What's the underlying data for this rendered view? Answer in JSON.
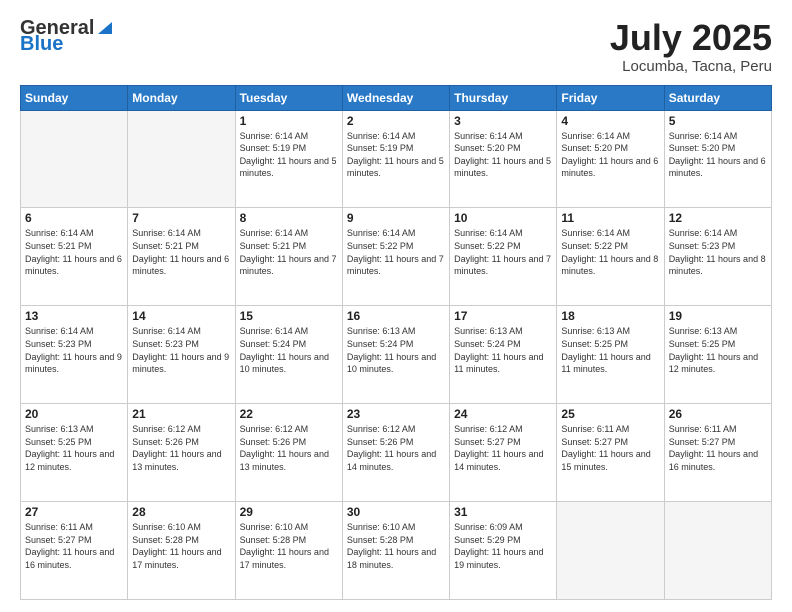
{
  "header": {
    "logo_general": "General",
    "logo_blue": "Blue",
    "month": "July 2025",
    "location": "Locumba, Tacna, Peru"
  },
  "weekdays": [
    "Sunday",
    "Monday",
    "Tuesday",
    "Wednesday",
    "Thursday",
    "Friday",
    "Saturday"
  ],
  "weeks": [
    [
      {
        "day": "",
        "info": ""
      },
      {
        "day": "",
        "info": ""
      },
      {
        "day": "1",
        "info": "Sunrise: 6:14 AM\nSunset: 5:19 PM\nDaylight: 11 hours and 5 minutes."
      },
      {
        "day": "2",
        "info": "Sunrise: 6:14 AM\nSunset: 5:19 PM\nDaylight: 11 hours and 5 minutes."
      },
      {
        "day": "3",
        "info": "Sunrise: 6:14 AM\nSunset: 5:20 PM\nDaylight: 11 hours and 5 minutes."
      },
      {
        "day": "4",
        "info": "Sunrise: 6:14 AM\nSunset: 5:20 PM\nDaylight: 11 hours and 6 minutes."
      },
      {
        "day": "5",
        "info": "Sunrise: 6:14 AM\nSunset: 5:20 PM\nDaylight: 11 hours and 6 minutes."
      }
    ],
    [
      {
        "day": "6",
        "info": "Sunrise: 6:14 AM\nSunset: 5:21 PM\nDaylight: 11 hours and 6 minutes."
      },
      {
        "day": "7",
        "info": "Sunrise: 6:14 AM\nSunset: 5:21 PM\nDaylight: 11 hours and 6 minutes."
      },
      {
        "day": "8",
        "info": "Sunrise: 6:14 AM\nSunset: 5:21 PM\nDaylight: 11 hours and 7 minutes."
      },
      {
        "day": "9",
        "info": "Sunrise: 6:14 AM\nSunset: 5:22 PM\nDaylight: 11 hours and 7 minutes."
      },
      {
        "day": "10",
        "info": "Sunrise: 6:14 AM\nSunset: 5:22 PM\nDaylight: 11 hours and 7 minutes."
      },
      {
        "day": "11",
        "info": "Sunrise: 6:14 AM\nSunset: 5:22 PM\nDaylight: 11 hours and 8 minutes."
      },
      {
        "day": "12",
        "info": "Sunrise: 6:14 AM\nSunset: 5:23 PM\nDaylight: 11 hours and 8 minutes."
      }
    ],
    [
      {
        "day": "13",
        "info": "Sunrise: 6:14 AM\nSunset: 5:23 PM\nDaylight: 11 hours and 9 minutes."
      },
      {
        "day": "14",
        "info": "Sunrise: 6:14 AM\nSunset: 5:23 PM\nDaylight: 11 hours and 9 minutes."
      },
      {
        "day": "15",
        "info": "Sunrise: 6:14 AM\nSunset: 5:24 PM\nDaylight: 11 hours and 10 minutes."
      },
      {
        "day": "16",
        "info": "Sunrise: 6:13 AM\nSunset: 5:24 PM\nDaylight: 11 hours and 10 minutes."
      },
      {
        "day": "17",
        "info": "Sunrise: 6:13 AM\nSunset: 5:24 PM\nDaylight: 11 hours and 11 minutes."
      },
      {
        "day": "18",
        "info": "Sunrise: 6:13 AM\nSunset: 5:25 PM\nDaylight: 11 hours and 11 minutes."
      },
      {
        "day": "19",
        "info": "Sunrise: 6:13 AM\nSunset: 5:25 PM\nDaylight: 11 hours and 12 minutes."
      }
    ],
    [
      {
        "day": "20",
        "info": "Sunrise: 6:13 AM\nSunset: 5:25 PM\nDaylight: 11 hours and 12 minutes."
      },
      {
        "day": "21",
        "info": "Sunrise: 6:12 AM\nSunset: 5:26 PM\nDaylight: 11 hours and 13 minutes."
      },
      {
        "day": "22",
        "info": "Sunrise: 6:12 AM\nSunset: 5:26 PM\nDaylight: 11 hours and 13 minutes."
      },
      {
        "day": "23",
        "info": "Sunrise: 6:12 AM\nSunset: 5:26 PM\nDaylight: 11 hours and 14 minutes."
      },
      {
        "day": "24",
        "info": "Sunrise: 6:12 AM\nSunset: 5:27 PM\nDaylight: 11 hours and 14 minutes."
      },
      {
        "day": "25",
        "info": "Sunrise: 6:11 AM\nSunset: 5:27 PM\nDaylight: 11 hours and 15 minutes."
      },
      {
        "day": "26",
        "info": "Sunrise: 6:11 AM\nSunset: 5:27 PM\nDaylight: 11 hours and 16 minutes."
      }
    ],
    [
      {
        "day": "27",
        "info": "Sunrise: 6:11 AM\nSunset: 5:27 PM\nDaylight: 11 hours and 16 minutes."
      },
      {
        "day": "28",
        "info": "Sunrise: 6:10 AM\nSunset: 5:28 PM\nDaylight: 11 hours and 17 minutes."
      },
      {
        "day": "29",
        "info": "Sunrise: 6:10 AM\nSunset: 5:28 PM\nDaylight: 11 hours and 17 minutes."
      },
      {
        "day": "30",
        "info": "Sunrise: 6:10 AM\nSunset: 5:28 PM\nDaylight: 11 hours and 18 minutes."
      },
      {
        "day": "31",
        "info": "Sunrise: 6:09 AM\nSunset: 5:29 PM\nDaylight: 11 hours and 19 minutes."
      },
      {
        "day": "",
        "info": ""
      },
      {
        "day": "",
        "info": ""
      }
    ]
  ]
}
